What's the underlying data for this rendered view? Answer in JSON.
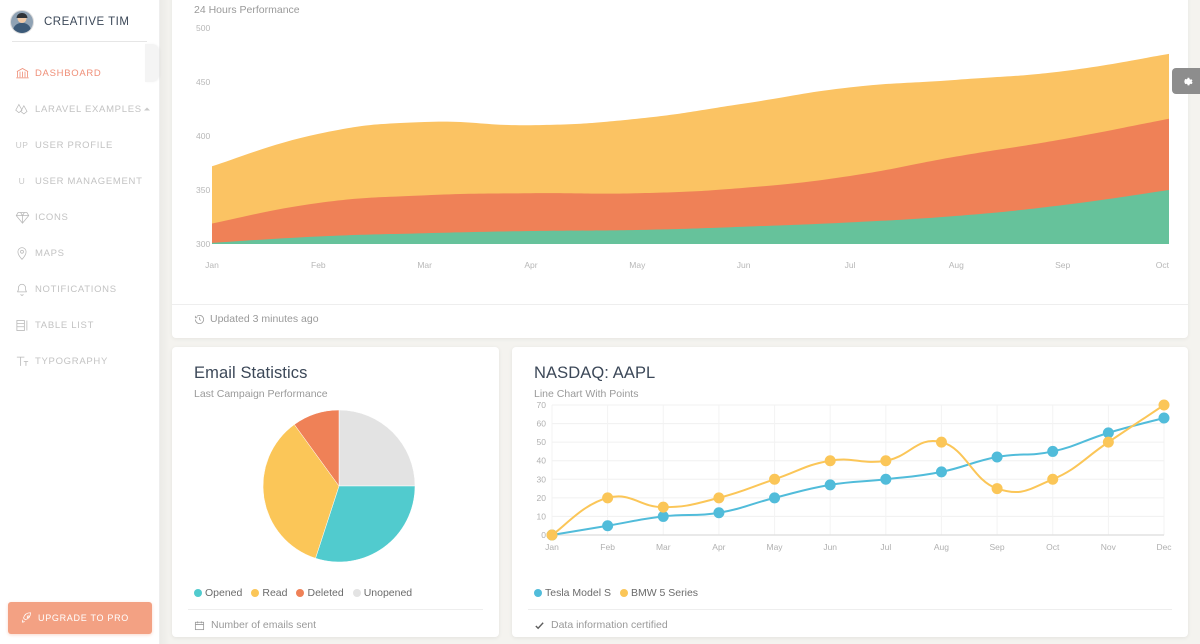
{
  "brand": {
    "name": "CREATIVE TIM",
    "avatar_icon": "user-avatar"
  },
  "sidebar": {
    "items": [
      {
        "label": "DASHBOARD",
        "icon": "bank-icon",
        "active": true
      },
      {
        "label": "LARAVEL EXAMPLES",
        "icon": "laravel-icon",
        "active": false,
        "caret": true
      },
      {
        "label": "USER PROFILE",
        "icon": "UP",
        "active": false,
        "sub": true
      },
      {
        "label": "USER MANAGEMENT",
        "icon": "U",
        "active": false,
        "sub": true
      },
      {
        "label": "ICONS",
        "icon": "diamond-icon",
        "active": false
      },
      {
        "label": "MAPS",
        "icon": "pin-icon",
        "active": false
      },
      {
        "label": "NOTIFICATIONS",
        "icon": "bell-icon",
        "active": false
      },
      {
        "label": "TABLE LIST",
        "icon": "table-icon",
        "active": false
      },
      {
        "label": "TYPOGRAPHY",
        "icon": "typography-icon",
        "active": false
      }
    ],
    "upgrade": {
      "label": "UPGRADE TO PRO",
      "icon": "rocket-icon",
      "color": "#f3a183"
    }
  },
  "settings_button": {
    "icon": "gear-icon"
  },
  "area_card": {
    "subtitle": "24 Hours Performance",
    "footer": "Updated 3 minutes ago",
    "footer_icon": "history-icon"
  },
  "email_card": {
    "title": "Email Statistics",
    "subtitle": "Last Campaign Performance",
    "footer": "Number of emails sent",
    "footer_icon": "calendar-icon",
    "legend": [
      {
        "label": "Opened",
        "color": "#51cbce"
      },
      {
        "label": "Read",
        "color": "#fbc658"
      },
      {
        "label": "Deleted",
        "color": "#ef8157"
      },
      {
        "label": "Unopened",
        "color": "#e3e3e3"
      }
    ]
  },
  "nasdaq_card": {
    "title": "NASDAQ: AAPL",
    "subtitle": "Line Chart With Points",
    "footer": "Data information certified",
    "footer_icon": "check-icon",
    "legend": [
      {
        "label": "Tesla Model S",
        "color": "#51bcda"
      },
      {
        "label": "BMW 5 Series",
        "color": "#fbc658"
      }
    ]
  },
  "chart_data": [
    {
      "id": "area-performance",
      "type": "area",
      "title": "24 Hours Performance",
      "stacked": true,
      "xlabel": "",
      "ylabel": "",
      "grid": false,
      "categories": [
        "Jan",
        "Feb",
        "Mar",
        "Apr",
        "May",
        "Jun",
        "Jul",
        "Aug",
        "Sep",
        "Oct"
      ],
      "yticks": [
        300,
        350,
        400,
        450,
        500
      ],
      "ylim": [
        300,
        500
      ],
      "series": [
        {
          "name": "series-green",
          "color": "#66c29b",
          "values": [
            301,
            307,
            310,
            312,
            313,
            316,
            320,
            326,
            336,
            350
          ]
        },
        {
          "name": "series-coral",
          "color": "#ef8157",
          "values": [
            319,
            338,
            345,
            347,
            347,
            352,
            363,
            381,
            397,
            416
          ]
        },
        {
          "name": "series-yellow",
          "color": "#fbc363",
          "values": [
            372,
            402,
            413,
            410,
            416,
            430,
            445,
            452,
            460,
            476
          ]
        }
      ]
    },
    {
      "id": "email-statistics-pie",
      "type": "pie",
      "title": "Email Statistics",
      "subtitle": "Last Campaign Performance",
      "labels": [
        "Unopened",
        "Opened",
        "Read",
        "Deleted"
      ],
      "values": [
        25,
        30,
        35,
        10
      ],
      "colors": [
        "#e3e3e3",
        "#51cbce",
        "#fbc658",
        "#ef8157"
      ],
      "legend_position": "bottom"
    },
    {
      "id": "nasdaq-aapl-line",
      "type": "line",
      "title": "NASDAQ: AAPL",
      "subtitle": "Line Chart With Points",
      "grid": true,
      "legend_position": "bottom",
      "categories": [
        "Jan",
        "Feb",
        "Mar",
        "Apr",
        "May",
        "Jun",
        "Jul",
        "Aug",
        "Sep",
        "Oct",
        "Nov",
        "Dec"
      ],
      "yticks": [
        0,
        10,
        20,
        30,
        40,
        50,
        60,
        70
      ],
      "ylim": [
        0,
        70
      ],
      "series": [
        {
          "name": "Tesla Model S",
          "color": "#51bcda",
          "values": [
            0,
            5,
            10,
            12,
            20,
            27,
            30,
            34,
            42,
            45,
            55,
            63
          ]
        },
        {
          "name": "BMW 5 Series",
          "color": "#fbc658",
          "values": [
            0,
            20,
            15,
            20,
            30,
            40,
            40,
            50,
            25,
            30,
            50,
            70
          ]
        }
      ]
    }
  ]
}
